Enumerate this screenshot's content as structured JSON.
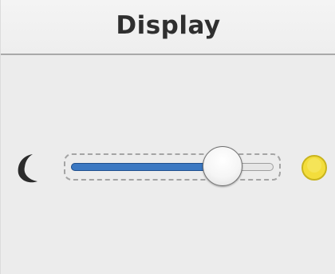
{
  "window": {
    "title": "Display"
  },
  "brightness": {
    "min_icon": "moon-icon",
    "max_icon": "sun-icon",
    "level": 0.81
  },
  "colors": {
    "accent": "#3b78c2",
    "sun": "#f3dd3c",
    "moon": "#2b2b2b"
  }
}
